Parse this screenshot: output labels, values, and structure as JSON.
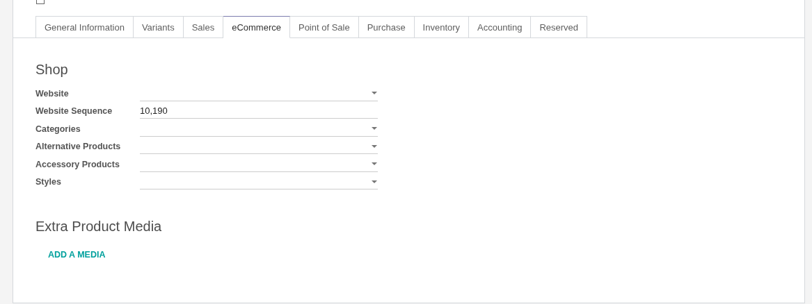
{
  "top_checkbox": {
    "checked": false
  },
  "tabs": [
    {
      "label": "General Information",
      "selected": false
    },
    {
      "label": "Variants",
      "selected": false
    },
    {
      "label": "Sales",
      "selected": false
    },
    {
      "label": "eCommerce",
      "selected": true
    },
    {
      "label": "Point of Sale",
      "selected": false
    },
    {
      "label": "Purchase",
      "selected": false
    },
    {
      "label": "Inventory",
      "selected": false
    },
    {
      "label": "Accounting",
      "selected": false
    },
    {
      "label": "Reserved",
      "selected": false
    }
  ],
  "shop": {
    "title": "Shop",
    "fields": [
      {
        "label": "Website",
        "kind": "select"
      },
      {
        "label": "Website Sequence",
        "kind": "text",
        "value": "10,190"
      },
      {
        "label": "Categories",
        "kind": "select"
      },
      {
        "label": "Alternative Products",
        "kind": "select"
      },
      {
        "label": "Accessory Products",
        "kind": "select"
      },
      {
        "label": "Styles",
        "kind": "select"
      }
    ]
  },
  "media": {
    "title": "Extra Product Media",
    "add_button": "ADD A MEDIA"
  }
}
